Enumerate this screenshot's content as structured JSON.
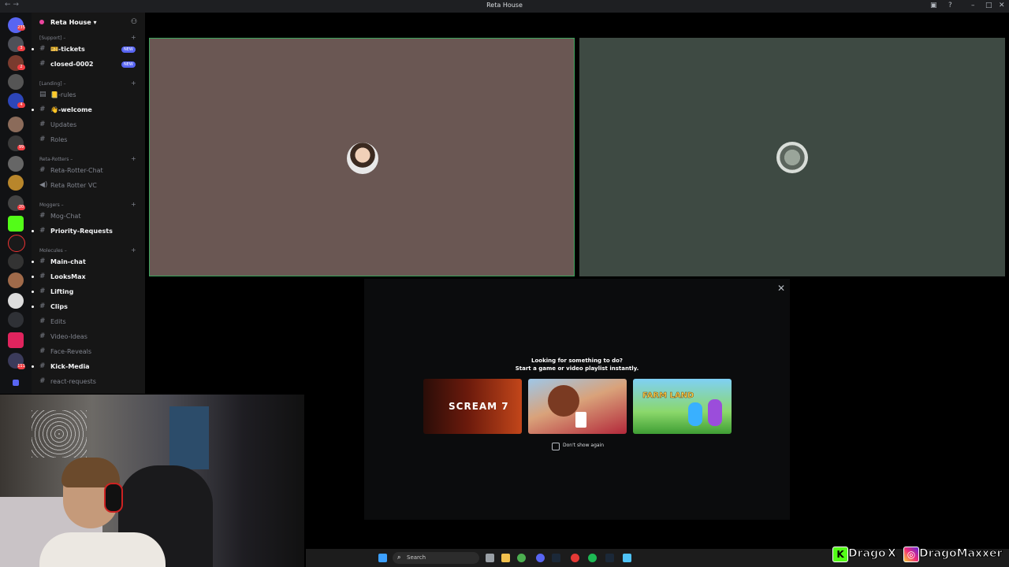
{
  "window": {
    "title": "Reta House"
  },
  "guild": {
    "name": "Reta House ▾"
  },
  "categories": {
    "support": "[Support] –",
    "landing": "[Landing] –",
    "reta_rotters": "Reta-Rotters –",
    "moggers": "Moggers –",
    "molecules": "Molecules –"
  },
  "channels": {
    "tickets": "🎫-tickets",
    "closed": "closed-0002",
    "rules": "📒-rules",
    "welcome": "👋-welcome",
    "updates": "Updates",
    "roles": "Roles",
    "reta_rotter_chat": "Reta-Rotter-Chat",
    "reta_rotter_vc": "Reta Rotter VC",
    "mog_chat": "Mog-Chat",
    "priority_requests": "Priority-Requests",
    "main_chat": "Main-chat",
    "looksmax": "LooksMax",
    "lifting": "Lifting",
    "clips": "Clips",
    "edits": "Edits",
    "video_ideas": "Video-Ideas",
    "face_reveals": "Face-Reveals",
    "kick_media": "Kick-Media",
    "react_requests": "react-requests"
  },
  "badges": {
    "new": "NEW"
  },
  "activity": {
    "title": "Looking for something to do?",
    "subtitle": "Start a game or video playlist instantly.",
    "games": [
      "SCREAM 7",
      "",
      "FARM LAND"
    ],
    "dont_show": "Don't show again"
  },
  "taskbar": {
    "search": "Search"
  },
  "socials": {
    "kick": "Drago",
    "x": "X",
    "instagram": "DragoMaxxer"
  },
  "server_badges": [
    "235",
    "3",
    "2",
    "4",
    "1",
    "99",
    "98",
    "1",
    "20",
    "1",
    "111"
  ],
  "colors": {
    "accent": "#5865f2",
    "speaking": "#3ba55c",
    "tile1": "#6a5753",
    "tile2": "#3e4a43"
  }
}
